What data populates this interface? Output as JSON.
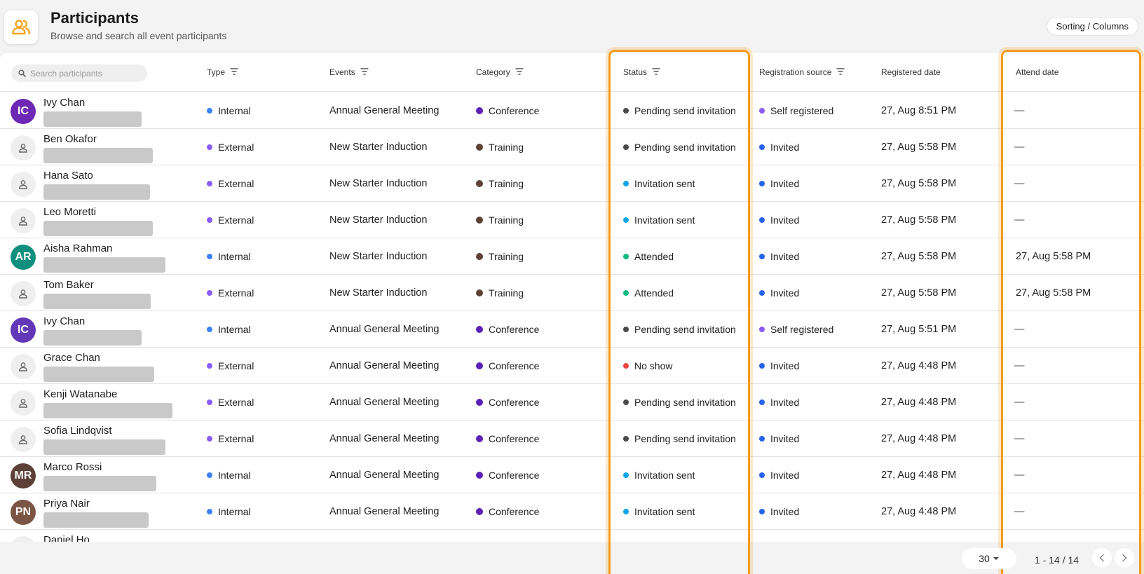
{
  "header": {
    "title": "Participants",
    "subtitle": "Browse and search all event participants",
    "sorting_button": "Sorting / Columns",
    "icon": "users-icon"
  },
  "search": {
    "placeholder": "Search participants"
  },
  "columns": {
    "type": "Type",
    "events": "Events",
    "category": "Category",
    "status": "Status",
    "registration_source": "Registration source",
    "registered_date": "Registered date",
    "attend_date": "Attend date"
  },
  "colors": {
    "accent": "#f5a623",
    "highlight": "#f59b1e",
    "internal": "#3b82f6",
    "external": "#8b5cf6",
    "conference": "#5b21b6",
    "training": "#5d4037",
    "pending": "#4b4b4b",
    "sent": "#0ea5e9",
    "attended": "#10b981",
    "noshow": "#ef4444",
    "self_registered": "#8b5cf6",
    "invited": "#2563eb"
  },
  "rows": [
    {
      "name": "Ivy Chan",
      "initials": "IC",
      "avatar_color": "#6d28b5",
      "type": "Internal",
      "event": "Annual General Meeting",
      "category": "Conference",
      "status": "Pending send invitation",
      "source": "Self registered",
      "registered": "27, Aug 8:51 PM",
      "attend": "—"
    },
    {
      "name": "Ben Okafor",
      "initials": "",
      "avatar_color": "",
      "type": "External",
      "event": "New Starter Induction",
      "category": "Training",
      "status": "Pending send invitation",
      "source": "Invited",
      "registered": "27, Aug 5:58 PM",
      "attend": "—"
    },
    {
      "name": "Hana Sato",
      "initials": "",
      "avatar_color": "",
      "type": "External",
      "event": "New Starter Induction",
      "category": "Training",
      "status": "Invitation sent",
      "source": "Invited",
      "registered": "27, Aug 5:58 PM",
      "attend": "—"
    },
    {
      "name": "Leo Moretti",
      "initials": "",
      "avatar_color": "",
      "type": "External",
      "event": "New Starter Induction",
      "category": "Training",
      "status": "Invitation sent",
      "source": "Invited",
      "registered": "27, Aug 5:58 PM",
      "attend": "—"
    },
    {
      "name": "Aisha Rahman",
      "initials": "AR",
      "avatar_color": "#0f8f7e",
      "type": "Internal",
      "event": "New Starter Induction",
      "category": "Training",
      "status": "Attended",
      "source": "Invited",
      "registered": "27, Aug 5:58 PM",
      "attend": "27, Aug 5:58 PM"
    },
    {
      "name": "Tom Baker",
      "initials": "",
      "avatar_color": "",
      "type": "External",
      "event": "New Starter Induction",
      "category": "Training",
      "status": "Attended",
      "source": "Invited",
      "registered": "27, Aug 5:58 PM",
      "attend": "27, Aug 5:58 PM"
    },
    {
      "name": "Ivy Chan",
      "initials": "IC",
      "avatar_color": "#6338b8",
      "type": "Internal",
      "event": "Annual General Meeting",
      "category": "Conference",
      "status": "Pending send invitation",
      "source": "Self registered",
      "registered": "27, Aug 5:51 PM",
      "attend": "—"
    },
    {
      "name": "Grace Chan",
      "initials": "",
      "avatar_color": "",
      "type": "External",
      "event": "Annual General Meeting",
      "category": "Conference",
      "status": "No show",
      "source": "Invited",
      "registered": "27, Aug 4:48 PM",
      "attend": "—"
    },
    {
      "name": "Kenji Watanabe",
      "initials": "",
      "avatar_color": "",
      "type": "External",
      "event": "Annual General Meeting",
      "category": "Conference",
      "status": "Pending send invitation",
      "source": "Invited",
      "registered": "27, Aug 4:48 PM",
      "attend": "—"
    },
    {
      "name": "Sofia Lindqvist",
      "initials": "",
      "avatar_color": "",
      "type": "External",
      "event": "Annual General Meeting",
      "category": "Conference",
      "status": "Pending send invitation",
      "source": "Invited",
      "registered": "27, Aug 4:48 PM",
      "attend": "—"
    },
    {
      "name": "Marco Rossi",
      "initials": "MR",
      "avatar_color": "#5d4037",
      "type": "Internal",
      "event": "Annual General Meeting",
      "category": "Conference",
      "status": "Invitation sent",
      "source": "Invited",
      "registered": "27, Aug 4:48 PM",
      "attend": "—"
    },
    {
      "name": "Priya Nair",
      "initials": "PN",
      "avatar_color": "#7b5544",
      "type": "Internal",
      "event": "Annual General Meeting",
      "category": "Conference",
      "status": "Invitation sent",
      "source": "Invited",
      "registered": "27, Aug 4:48 PM",
      "attend": "—"
    },
    {
      "name": "Daniel Ho",
      "initials": "",
      "avatar_color": "",
      "type": "",
      "event": "",
      "category": "",
      "status": "",
      "source": "",
      "registered": "",
      "attend": ""
    }
  ],
  "pagination": {
    "page_size": "30",
    "range": "1 - 14 / 14"
  }
}
